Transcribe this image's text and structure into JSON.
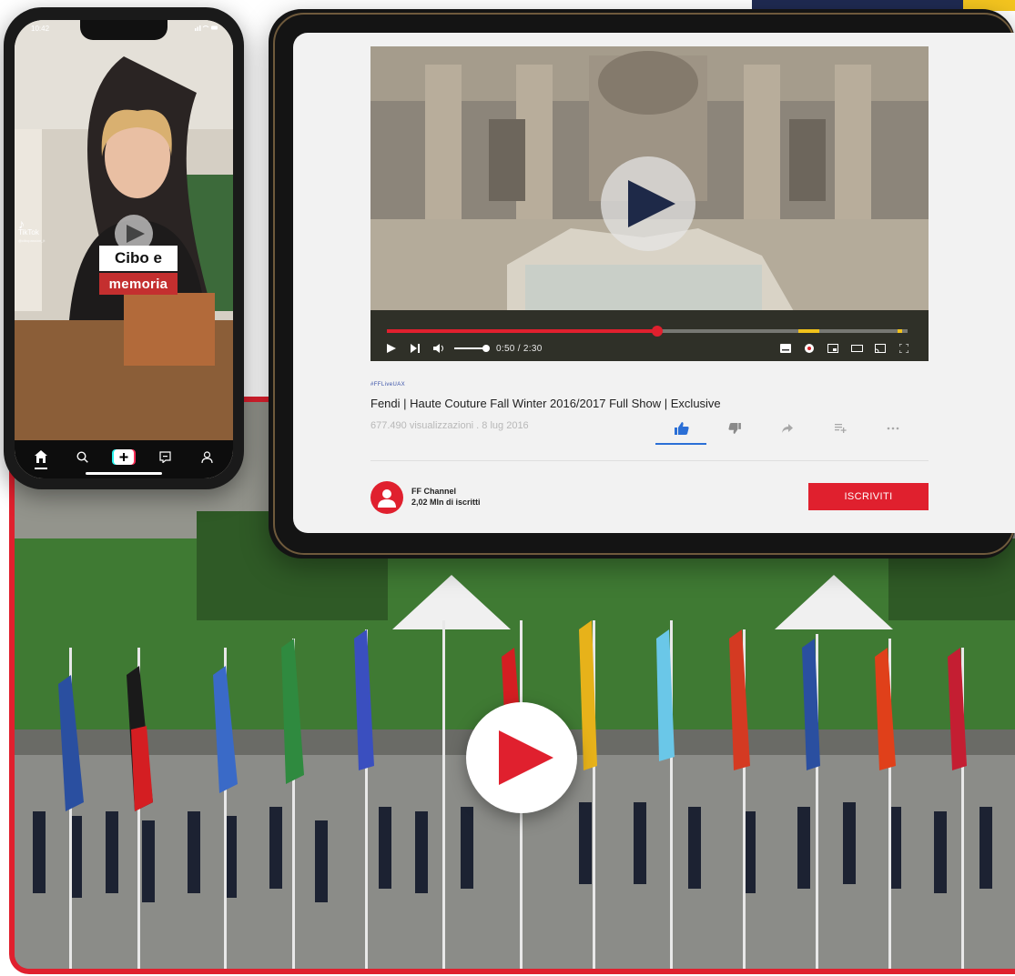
{
  "colors": {
    "accent_red": "#e0202e",
    "navy": "#1f2a52",
    "gold": "#f4c51f",
    "link_blue": "#2b6fd6"
  },
  "phone": {
    "status_time": "10:42",
    "status_icons": "signal wifi battery",
    "app": "TikTok",
    "handle": "@cibopassion_it",
    "caption_line_1": "Cibo e",
    "caption_line_2": "memoria",
    "nav_icons": [
      "home-icon",
      "search-icon",
      "create-plus-icon",
      "inbox-icon",
      "profile-icon"
    ]
  },
  "video": {
    "hashtag": "#FFLiveUAX",
    "title": "Fendi | Haute Couture Fall Winter 2016/2017 Full Show | Exclusive",
    "meta": "677.490 visualizzazioni . 8 lug 2016",
    "time": "0:50 / 2:30",
    "progress_fraction": 0.52,
    "action_icons": [
      "thumbs-up-icon",
      "thumbs-down-icon",
      "share-icon",
      "add-to-playlist-icon",
      "more-icon"
    ],
    "control_icons": [
      "play-icon",
      "next-icon",
      "volume-icon",
      "subtitles-icon",
      "settings-icon",
      "miniplayer-icon",
      "theater-icon",
      "cast-icon",
      "fullscreen-icon"
    ]
  },
  "channel": {
    "name": "FF Channel",
    "subscribers": "2,02 Mln di iscritti",
    "subscribe_label": "ISCRIVITI"
  }
}
